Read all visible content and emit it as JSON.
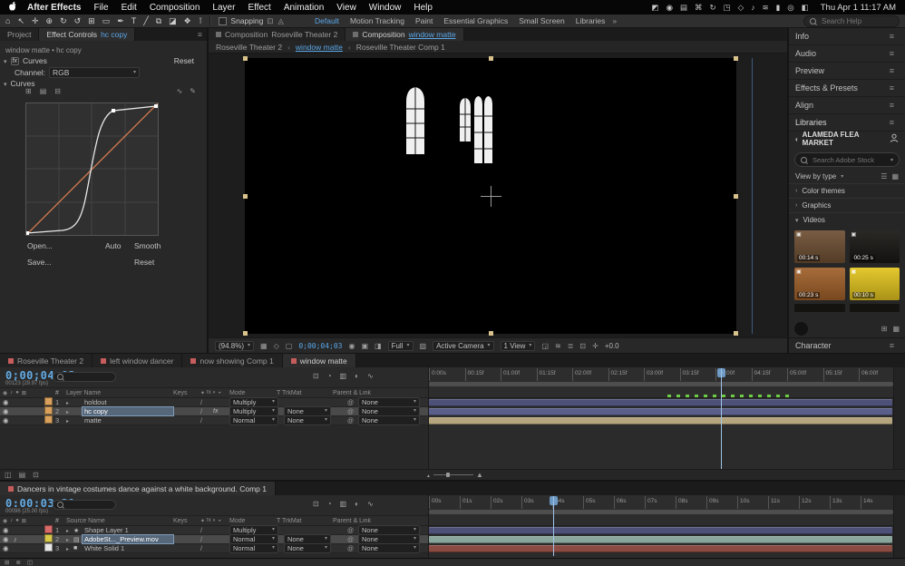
{
  "colors": {
    "accent-blue": "#5aa7e8",
    "timecode-blue": "#63abe4",
    "bar-purple": "#4d5178",
    "bar-tan": "#b5a57e",
    "bar-teal": "#8aa69c",
    "bar-red": "#8a4c42",
    "curve-orange": "#e07f4f",
    "handle-tan": "#d9c38c",
    "keyframe-green": "#6ecb45"
  },
  "menubar": {
    "app_name": "After Effects",
    "items": [
      "File",
      "Edit",
      "Composition",
      "Layer",
      "Effect",
      "Animation",
      "View",
      "Window",
      "Help"
    ],
    "status_icons": [
      {
        "name": "creative-cloud-icon",
        "glyph": "◩"
      },
      {
        "name": "screen-record-icon",
        "glyph": "◉"
      },
      {
        "name": "display-icon",
        "glyph": "▤"
      },
      {
        "name": "keyboard-icon",
        "glyph": "⌘"
      },
      {
        "name": "sync-icon",
        "glyph": "↻"
      },
      {
        "name": "airplay-icon",
        "glyph": "◳"
      },
      {
        "name": "bluetooth-icon",
        "glyph": "◇"
      },
      {
        "name": "volume-icon",
        "glyph": "♪"
      },
      {
        "name": "wifi-icon",
        "glyph": "≋"
      },
      {
        "name": "battery-icon",
        "glyph": "▮"
      },
      {
        "name": "spotlight-icon",
        "glyph": "◎"
      },
      {
        "name": "control-center-icon",
        "glyph": "◧"
      }
    ],
    "clock": "Thu Apr 1 11:17 AM"
  },
  "toolbar": {
    "tools": [
      {
        "name": "home-tool",
        "glyph": "⌂"
      },
      {
        "name": "selection-tool",
        "glyph": "↖"
      },
      {
        "name": "hand-tool",
        "glyph": "✛"
      },
      {
        "name": "zoom-tool",
        "glyph": "⊕"
      },
      {
        "name": "orbit-camera-tool",
        "glyph": "↻"
      },
      {
        "name": "rotation-tool",
        "glyph": "↺"
      },
      {
        "name": "pan-behind-tool",
        "glyph": "⊞"
      },
      {
        "name": "shape-tool",
        "glyph": "▭"
      },
      {
        "name": "pen-tool",
        "glyph": "✒"
      },
      {
        "name": "type-tool",
        "glyph": "T"
      },
      {
        "name": "brush-tool",
        "glyph": "╱"
      },
      {
        "name": "clone-stamp-tool",
        "glyph": "⧉"
      },
      {
        "name": "eraser-tool",
        "glyph": "◪"
      },
      {
        "name": "roto-brush-tool",
        "glyph": "❖"
      },
      {
        "name": "puppet-pin-tool",
        "glyph": "⊺"
      }
    ],
    "snapping_label": "Snapping",
    "snap_icons": [
      {
        "name": "snap-edges-icon",
        "glyph": "⊡"
      },
      {
        "name": "snap-features-icon",
        "glyph": "◬"
      }
    ],
    "workspaces": [
      {
        "label": "Default",
        "selected": true
      },
      {
        "label": "Motion Tracking"
      },
      {
        "label": "Paint"
      },
      {
        "label": "Essential Graphics"
      },
      {
        "label": "Small Screen"
      },
      {
        "label": "Libraries"
      }
    ],
    "overflow_label": "»",
    "search_placeholder": "Search Help"
  },
  "effect_controls": {
    "tab_project": "Project",
    "tab_title": "Effect Controls",
    "tab_target": "hc copy",
    "context": "window matte • hc copy",
    "fx_badge": "fx",
    "effect_name": "Curves",
    "reset_label": "Reset",
    "channel_label": "Channel:",
    "channel_value": "RGB",
    "group_label": "Curves",
    "curve_icons": [
      {
        "name": "channel-grid-icon",
        "glyph": "⊞"
      },
      {
        "name": "histogram-icon",
        "glyph": "▤"
      },
      {
        "name": "grid-detail-icon",
        "glyph": "⊟"
      }
    ],
    "curve_tools": [
      {
        "name": "bezier-curve-icon",
        "glyph": "∿"
      },
      {
        "name": "pencil-curve-icon",
        "glyph": "✎"
      }
    ],
    "open_label": "Open...",
    "save_label": "Save...",
    "auto_label": "Auto",
    "smooth_label": "Smooth",
    "reset_button_label": "Reset"
  },
  "composition": {
    "tabs": [
      {
        "prefix": "Composition",
        "name": "Roseville Theater 2"
      },
      {
        "prefix": "Composition",
        "name": "window matte",
        "selected": true
      }
    ],
    "breadcrumb": [
      {
        "label": "Roseville Theater 2"
      },
      {
        "label": "window matte",
        "selected": true
      },
      {
        "label": "Roseville Theater Comp 1"
      }
    ],
    "statusbar": {
      "zoom": "(94.8%)",
      "timecode": "0;00;04;03",
      "resolution": "Full",
      "camera": "Active Camera",
      "view_layout": "1 View",
      "exposure": "+0.0",
      "icons_left": [
        {
          "name": "grid-and-guides-icon",
          "glyph": "▦"
        },
        {
          "name": "mask-visibility-icon",
          "glyph": "◇"
        },
        {
          "name": "region-of-interest-icon",
          "glyph": "▢"
        }
      ],
      "icons_mid": [
        {
          "name": "snapshot-icon",
          "glyph": "◉"
        },
        {
          "name": "show-snapshot-icon",
          "glyph": "▣"
        },
        {
          "name": "channels-icon",
          "glyph": "◨"
        }
      ],
      "icons_right": [
        {
          "name": "transparency-grid-icon",
          "glyph": "▨"
        }
      ],
      "icons_end": [
        {
          "name": "pixel-aspect-icon",
          "glyph": "◲"
        },
        {
          "name": "fast-previews-icon",
          "glyph": "≋"
        },
        {
          "name": "timeline-icon",
          "glyph": "≣"
        },
        {
          "name": "flowchart-icon",
          "glyph": "⊡"
        },
        {
          "name": "reset-exposure-icon",
          "glyph": "✛"
        }
      ]
    }
  },
  "right_panels": {
    "stacked": [
      "Info",
      "Audio",
      "Preview",
      "Effects & Presets",
      "Align"
    ],
    "libraries": {
      "title": "Libraries",
      "back_chevron": "‹",
      "library_name": "ALAMEDA FLEA MARKET",
      "search_placeholder": "Search Adobe Stock",
      "view_by": "View by type",
      "view_icons": [
        {
          "name": "list-view-icon",
          "glyph": "☰"
        },
        {
          "name": "grid-view-icon",
          "glyph": "▦"
        }
      ],
      "sections": [
        {
          "chevron": "›",
          "label": "Color themes"
        },
        {
          "chevron": "›",
          "label": "Graphics"
        },
        {
          "chevron": "▾",
          "label": "Videos"
        }
      ],
      "videos": [
        {
          "duration": "00:14 s",
          "color": "#6e4f33"
        },
        {
          "duration": "00:25 s",
          "color": "#191714"
        },
        {
          "duration": "00:23 s",
          "color": "#a0602a"
        },
        {
          "duration": "00:10 s",
          "color": "#e2c41e"
        }
      ]
    },
    "character_title": "Character"
  },
  "timeline1": {
    "tabs": [
      {
        "label": "Roseville Theater 2",
        "color": "#c75c5c"
      },
      {
        "label": "left window dancer",
        "color": "#c75c5c"
      },
      {
        "label": "now showing Comp 1",
        "color": "#c75c5c"
      },
      {
        "label": "window matte",
        "color": "#c75c5c",
        "selected": true
      }
    ],
    "timecode": "0;00;04;03",
    "frame_info": "00123 (29.97 fps)",
    "panel_icons": [
      {
        "name": "mini-flowchart-icon",
        "glyph": "⊡"
      },
      {
        "name": "draft-3d-icon",
        "glyph": "◔"
      },
      {
        "name": "frame-blend-icon",
        "glyph": "▥"
      },
      {
        "name": "motion-blur-icon",
        "glyph": "◐"
      },
      {
        "name": "graph-editor-icon",
        "glyph": "∿"
      }
    ],
    "header_icons": [
      {
        "name": "video-column-icon",
        "glyph": "◉"
      },
      {
        "name": "audio-column-icon",
        "glyph": "♪"
      },
      {
        "name": "solo-column-icon",
        "glyph": "●"
      },
      {
        "name": "lock-column-icon",
        "glyph": "⊠"
      }
    ],
    "switch_icons": [
      {
        "name": "collapse-column-icon",
        "glyph": "✦"
      },
      {
        "name": "fx-column-icon",
        "glyph": "fx"
      },
      {
        "name": "motion-blur-column-icon",
        "glyph": "◐"
      },
      {
        "name": "3d-column-icon",
        "glyph": "◒"
      }
    ],
    "columns": {
      "number": "#",
      "name": "Layer Name",
      "keys": "Keys",
      "mode": "Mode",
      "trkmat": "T TrkMat",
      "parent": "Parent & Link"
    },
    "ruler": [
      "0:00s",
      "00:15f",
      "01:00f",
      "01:15f",
      "02:00f",
      "02:15f",
      "03:00f",
      "03:15f",
      "04:00f",
      "04:15f",
      "05:00f",
      "05:15f",
      "06:00f"
    ],
    "layers": [
      {
        "num": "1",
        "eye": "◉",
        "audio": "",
        "swatch": "#d8a05c",
        "icon": "",
        "name": "holdout",
        "quality": "/",
        "fx": "",
        "mode": "Multiply",
        "trkmat": "",
        "parent": "None",
        "bar_color": "#4d5178"
      },
      {
        "num": "2",
        "eye": "◉",
        "audio": "",
        "swatch": "#d8a05c",
        "icon": "",
        "name": "hc copy",
        "quality": "/",
        "fx": "fx",
        "mode": "Multiply",
        "trkmat": "None",
        "parent": "None",
        "bar_color": "#5a5f8a",
        "selected": true
      },
      {
        "num": "3",
        "eye": "◉",
        "audio": "",
        "swatch": "#d8a05c",
        "icon": "",
        "name": "matte",
        "quality": "/",
        "fx": "",
        "mode": "Normal",
        "trkmat": "None",
        "parent": "None",
        "bar_color": "#b5a57e"
      }
    ],
    "foot_icons": [
      {
        "name": "expand-columns-icon",
        "glyph": "◫"
      },
      {
        "name": "modes-columns-icon",
        "glyph": "▤"
      },
      {
        "name": "in-out-columns-icon",
        "glyph": "⊡"
      }
    ]
  },
  "timeline2": {
    "tabs": [
      {
        "label": "Dancers in vintage costumes dance against a white background. Comp 1",
        "color": "#c75c5c",
        "selected": true
      }
    ],
    "timecode": "0:00:03:21",
    "frame_info": "00096 (25.00 fps)",
    "panel_icons": [
      {
        "name": "mini-flowchart-icon",
        "glyph": "⊡"
      },
      {
        "name": "draft-3d-icon",
        "glyph": "◔"
      },
      {
        "name": "frame-blend-icon",
        "glyph": "▥"
      },
      {
        "name": "motion-blur-icon",
        "glyph": "◐"
      },
      {
        "name": "graph-editor-icon",
        "glyph": "∿"
      }
    ],
    "header_icons": [
      {
        "name": "video-column-icon",
        "glyph": "◉"
      },
      {
        "name": "audio-column-icon",
        "glyph": "♪"
      },
      {
        "name": "solo-column-icon",
        "glyph": "●"
      },
      {
        "name": "lock-column-icon",
        "glyph": "⊠"
      }
    ],
    "switch_icons": [
      {
        "name": "collapse-column-icon",
        "glyph": "✦"
      },
      {
        "name": "fx-column-icon",
        "glyph": "fx"
      },
      {
        "name": "motion-blur-column-icon",
        "glyph": "◐"
      },
      {
        "name": "3d-column-icon",
        "glyph": "◒"
      }
    ],
    "columns": {
      "number": "#",
      "name": "Source Name",
      "keys": "Keys",
      "mode": "Mode",
      "trkmat": "T TrkMat",
      "parent": "Parent & Link"
    },
    "ruler": [
      "00s",
      "01s",
      "02s",
      "03s",
      "04s",
      "05s",
      "06s",
      "07s",
      "08s",
      "09s",
      "10s",
      "11s",
      "12s",
      "13s",
      "14s"
    ],
    "layers": [
      {
        "num": "1",
        "eye": "◉",
        "audio": "",
        "swatch": "#d86a6a",
        "icon": "★",
        "name": "Shape Layer 1",
        "quality": "/",
        "fx": "",
        "mode": "Multiply",
        "trkmat": "",
        "parent": "None",
        "bar_color": "#4d5178"
      },
      {
        "num": "2",
        "eye": "◉",
        "audio": "♪",
        "swatch": "#d8c84a",
        "icon": "▤",
        "name": "AdobeSt..._Preview.mov",
        "quality": "/",
        "fx": "",
        "mode": "Normal",
        "trkmat": "None",
        "parent": "None",
        "bar_color": "#8aa69c",
        "selected": true
      },
      {
        "num": "3",
        "eye": "◉",
        "audio": "",
        "swatch": "#e8e8e8",
        "icon": "■",
        "name": "White Solid 1",
        "quality": "/",
        "fx": "",
        "mode": "Normal",
        "trkmat": "None",
        "parent": "None",
        "bar_color": "#8a4c42"
      }
    ]
  },
  "statusbar_icons": [
    {
      "name": "composition-panel-icon",
      "glyph": "⊞"
    },
    {
      "name": "timeline-panel-icon",
      "glyph": "≣"
    },
    {
      "name": "info-panel-icon",
      "glyph": "◫"
    }
  ]
}
